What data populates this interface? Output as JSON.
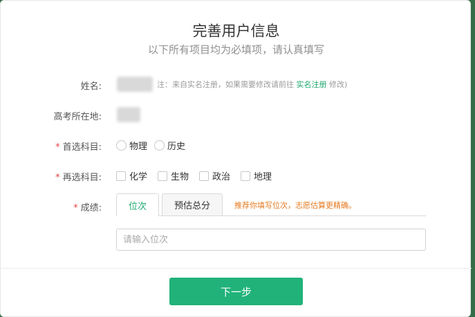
{
  "dialog": {
    "title": "完善用户信息",
    "subtitle": "以下所有项目均为必填项，请认真填写"
  },
  "form": {
    "name": {
      "label": "姓名:",
      "note_prefix": "注：来自实名注册，如果需要修改请前往",
      "note_link": "实名注册",
      "note_suffix": "修改)"
    },
    "exam_location": {
      "label": "高考所在地:"
    },
    "first_subject": {
      "required_mark": "*",
      "label": "首选科目:",
      "options": [
        "物理",
        "历史"
      ]
    },
    "second_subject": {
      "required_mark": "*",
      "label": "再选科目:",
      "options": [
        "化学",
        "生物",
        "政治",
        "地理"
      ]
    },
    "score": {
      "required_mark": "*",
      "label": "成绩:",
      "tabs": [
        "位次",
        "预估总分"
      ],
      "hint": "推荐你填写位次，志愿估算更精确。",
      "input_placeholder": "请输入位次",
      "input_value": ""
    }
  },
  "footer": {
    "next_label": "下一步"
  },
  "colors": {
    "accent": "#21b27a",
    "link": "#1fa86e",
    "hint": "#e57a21",
    "required": "#e04545"
  }
}
